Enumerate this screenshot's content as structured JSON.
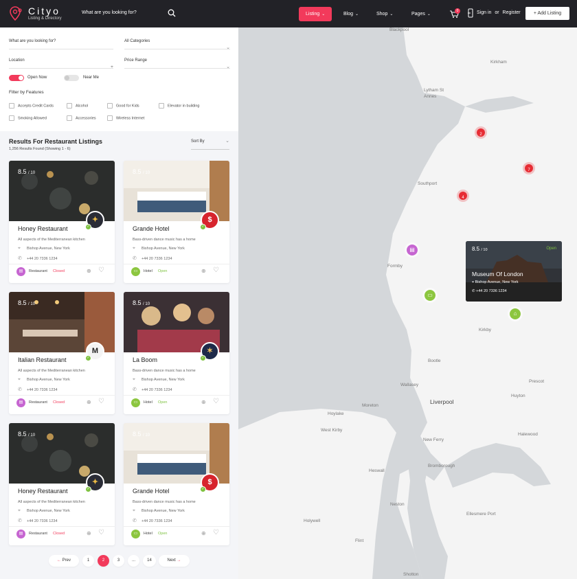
{
  "header": {
    "brand": "Cityo",
    "tagline": "Listing & Directory",
    "search_placeholder": "What are you looking for?",
    "nav": [
      {
        "label": "Listing",
        "active": true
      },
      {
        "label": "Blog",
        "active": false
      },
      {
        "label": "Shop",
        "active": false
      },
      {
        "label": "Pages",
        "active": false
      }
    ],
    "cart_count": "0",
    "sign_in": "Sign in",
    "or": "or",
    "register": "Register",
    "add_listing": "Add Listing",
    "accent": "#f23a5b"
  },
  "filters": {
    "keyword_placeholder": "What are you looking for?",
    "category": "All Categories",
    "location_placeholder": "Location",
    "price_range": "Price Range",
    "open_now": {
      "label": "Open Now",
      "on": true
    },
    "near_me": {
      "label": "Near Me",
      "on": false
    },
    "features_title": "Filter by Features",
    "features": [
      "Accepts Credit Cards",
      "Alcohol",
      "Good for Kids",
      "Elevator in building",
      "Smoking Allowed",
      "Accessories",
      "Wireless Internet"
    ]
  },
  "results": {
    "title": "Results For Restaurant Listings",
    "subtitle": "1,256 Results Found (Showing 1 - 6)",
    "sort_label": "Sort By"
  },
  "listings": [
    {
      "rating": "8.5",
      "rating_max": "/ 10",
      "name": "Honey Restaurant",
      "desc": "All aspects of the Mediterranean kitchen",
      "address": "Bishop Avenue, New York",
      "phone": "+44 20 7336 1234",
      "category": "Restaurant",
      "status": "Closed"
    },
    {
      "rating": "8.5",
      "rating_max": "/ 10",
      "name": "Grande Hotel",
      "desc": "Bass-driven dance music has a home",
      "address": "Bishop Avenue, New York",
      "phone": "+44 20 7336 1234",
      "category": "Hotel",
      "status": "Open"
    },
    {
      "rating": "8.5",
      "rating_max": "/ 10",
      "name": "Italian Restaurant",
      "desc": "All aspects of the Mediterranean kitchen",
      "address": "Bishop Avenue, New York",
      "phone": "+44 20 7336 1234",
      "category": "Restaurant",
      "status": "Closed"
    },
    {
      "rating": "8.5",
      "rating_max": "/ 10",
      "name": "La Boom",
      "desc": "Bass-driven dance music has a home",
      "address": "Bishop Avenue, New York",
      "phone": "+44 20 7336 1234",
      "category": "Hotel",
      "status": "Open"
    },
    {
      "rating": "8.5",
      "rating_max": "/ 10",
      "name": "Honey Restaurant",
      "desc": "All aspects of the Mediterranean kitchen",
      "address": "Bishop Avenue, New York",
      "phone": "+44 20 7336 1234",
      "category": "Restaurant",
      "status": "Closed"
    },
    {
      "rating": "8.5",
      "rating_max": "/ 10",
      "name": "Grande Hotel",
      "desc": "Bass-driven dance music has a home",
      "address": "Bishop Avenue, New York",
      "phone": "+44 20 7336 1234",
      "category": "Hotel",
      "status": "Open"
    }
  ],
  "pagination": {
    "prev": "Prev",
    "pages": [
      "1",
      "2",
      "3",
      "...",
      "14"
    ],
    "current": "2",
    "next": "Next"
  },
  "map": {
    "labels": [
      "Blackpool",
      "Kirkham",
      "Lytham St Annes",
      "Southport",
      "Formby",
      "Kirkby",
      "Bootle",
      "Wallasey",
      "Liverpool",
      "Moreton",
      "Hoylake",
      "Prescot",
      "Huyton",
      "West Kirby",
      "New Ferry",
      "Halewood",
      "Bromborough",
      "Heswall",
      "Neston",
      "Ellesmere Port",
      "Holywell",
      "Flint",
      "Shotton"
    ],
    "clusters": [
      "2",
      "7",
      "4"
    ],
    "popup": {
      "rating": "8.5",
      "rating_max": "/ 10",
      "status": "Open",
      "title": "Museum Of London",
      "address": "Bishop Avenue, New York",
      "phone": "+44 20 7336 1234"
    }
  }
}
